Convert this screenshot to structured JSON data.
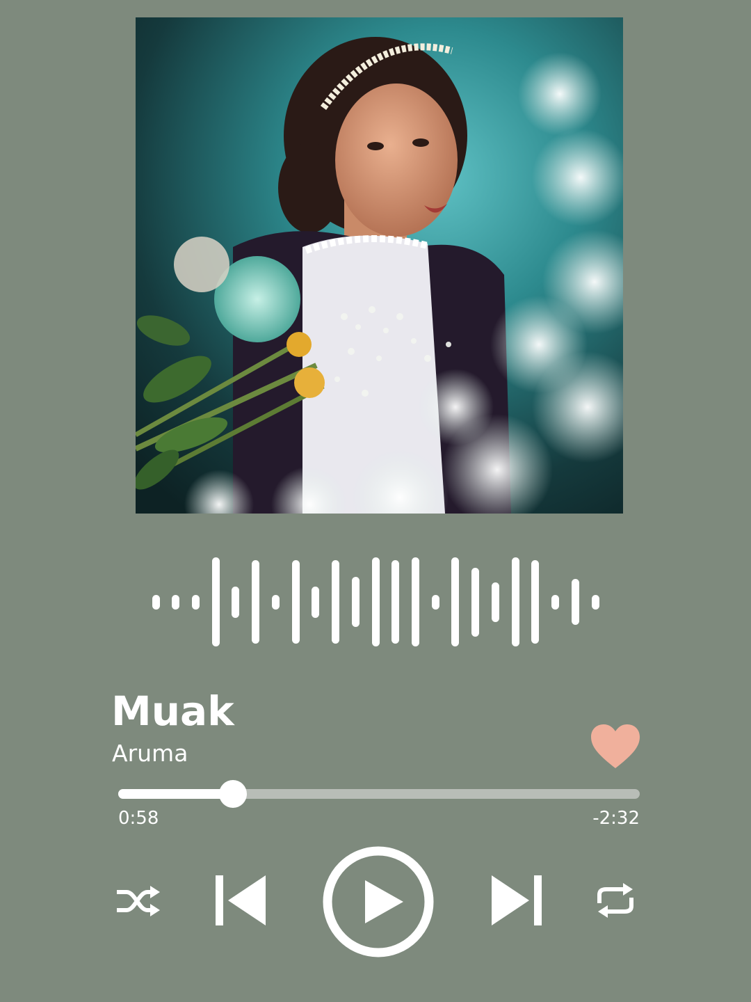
{
  "album_art": {
    "description_icon": "album-cover-image"
  },
  "waveform": {
    "bars": [
      {
        "h": 0.14
      },
      {
        "h": 0.14
      },
      {
        "h": 0.14
      },
      {
        "h": 0.85
      },
      {
        "h": 0.3
      },
      {
        "h": 0.8
      },
      {
        "h": 0.14
      },
      {
        "h": 0.8
      },
      {
        "h": 0.3
      },
      {
        "h": 0.8
      },
      {
        "h": 0.48
      },
      {
        "h": 0.85
      },
      {
        "h": 0.8
      },
      {
        "h": 0.85
      },
      {
        "h": 0.14
      },
      {
        "h": 0.85
      },
      {
        "h": 0.66
      },
      {
        "h": 0.38
      },
      {
        "h": 0.85
      },
      {
        "h": 0.8
      },
      {
        "h": 0.14
      },
      {
        "h": 0.44
      },
      {
        "h": 0.14
      }
    ]
  },
  "track": {
    "title": "Muak",
    "artist": "Aruma"
  },
  "favorite": {
    "liked": true,
    "color": "#f0b09c"
  },
  "progress": {
    "fraction": 0.22,
    "elapsed": "0:58",
    "remaining": "-2:32"
  },
  "controls": {
    "shuffle": "shuffle-icon",
    "previous": "skip-previous-icon",
    "play": "play-icon",
    "next": "skip-next-icon",
    "repeat": "repeat-icon"
  },
  "colors": {
    "background": "#7e8a7d",
    "foreground": "#ffffff",
    "track_bg": "#b8bdb7",
    "heart": "#f0b09c"
  }
}
